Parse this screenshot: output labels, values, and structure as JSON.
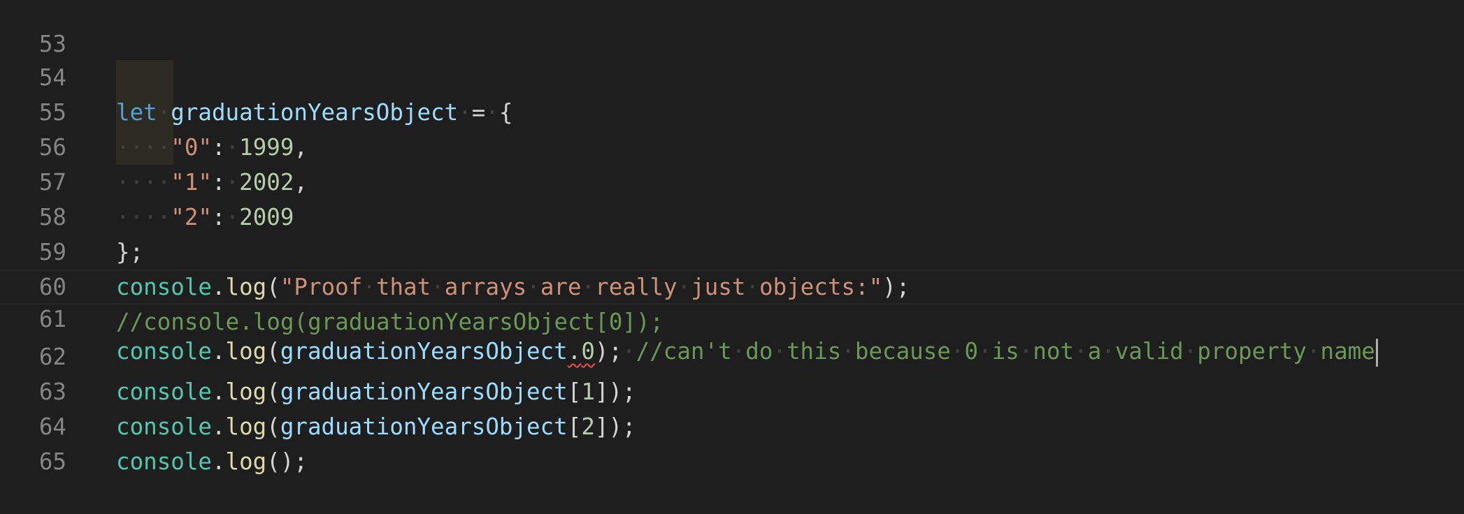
{
  "line_numbers": [
    "53",
    "54",
    "55",
    "56",
    "57",
    "58",
    "59",
    "60",
    "61",
    "62",
    "63",
    "64",
    "65"
  ],
  "code": {
    "l54": {
      "kw": "let",
      "var": "graduationYearsObject",
      "op": "=",
      "brace": "{"
    },
    "l55": {
      "key": "\"0\"",
      "colon": ":",
      "value": "1999",
      "comma": ","
    },
    "l56": {
      "key": "\"1\"",
      "colon": ":",
      "value": "2002",
      "comma": ","
    },
    "l57": {
      "key": "\"2\"",
      "colon": ":",
      "value": "2009"
    },
    "l58": {
      "close": "};"
    },
    "l59": {
      "obj": "console",
      "fn": "log",
      "open": "(",
      "str": "\"Proof that arrays are really just objects:\"",
      "close": ");"
    },
    "l60": {
      "comment": "//console.log(graduationYearsObject[0]);"
    },
    "l61": {
      "obj": "console",
      "fn": "log",
      "open": "(",
      "var": "graduationYearsObject",
      "dot": ".",
      "prop": "0",
      "close": ");",
      "comment": "//can't do this because 0 is not a valid property name"
    },
    "l62": {
      "obj": "console",
      "fn": "log",
      "open": "(",
      "var": "graduationYearsObject",
      "lb": "[",
      "num": "1",
      "close": "]);"
    },
    "l63": {
      "obj": "console",
      "fn": "log",
      "open": "(",
      "var": "graduationYearsObject",
      "lb": "[",
      "num": "2",
      "close": "]);"
    },
    "l64": {
      "obj": "console",
      "fn": "log",
      "close": "();"
    }
  },
  "whitespace_glyph": "····",
  "space_glyph": "·",
  "colors": {
    "background": "#1e1e1e",
    "keyword": "#569cd6",
    "variable": "#9cdcfe",
    "string": "#ce9178",
    "number": "#b5cea8",
    "function": "#dcdcaa",
    "object": "#4ec9b0",
    "comment": "#6a9955",
    "error_squiggle": "#f14c4c"
  }
}
